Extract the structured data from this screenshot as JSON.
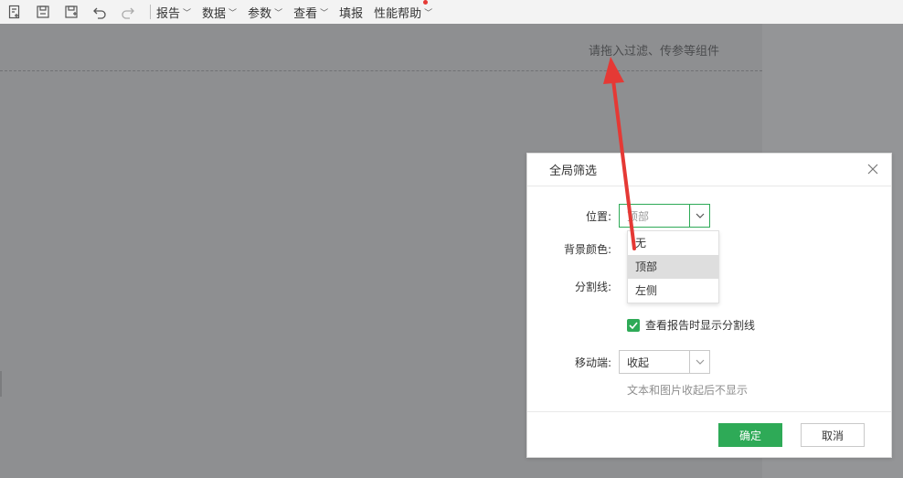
{
  "toolbar": {
    "icons": [
      "new-report-icon",
      "save-icon",
      "save-as-icon",
      "undo-icon",
      "redo-icon"
    ],
    "menus": [
      {
        "label": "报告",
        "has_arrow": true
      },
      {
        "label": "数据",
        "has_arrow": true
      },
      {
        "label": "参数",
        "has_arrow": true
      },
      {
        "label": "查看",
        "has_arrow": true
      },
      {
        "label": "填报",
        "has_arrow": false
      },
      {
        "label": "性能帮助",
        "has_arrow": true
      }
    ]
  },
  "canvas": {
    "filter_hint": "请拖入过滤、传参等组件"
  },
  "dialog": {
    "title": "全局筛选",
    "position": {
      "label": "位置:",
      "value": "顶部"
    },
    "position_options": [
      "无",
      "顶部",
      "左侧"
    ],
    "selected_option": "顶部",
    "bg_color_label": "背景颜色:",
    "divider_label": "分割线:",
    "show_divider": {
      "label": "查看报告时显示分割线",
      "checked": true
    },
    "mobile": {
      "label": "移动端:",
      "value": "收起"
    },
    "mobile_note": "文本和图片收起后不显示",
    "ok_label": "确定",
    "cancel_label": "取消"
  },
  "colors": {
    "accent": "#2eaa57",
    "annotation": "#e53935"
  }
}
